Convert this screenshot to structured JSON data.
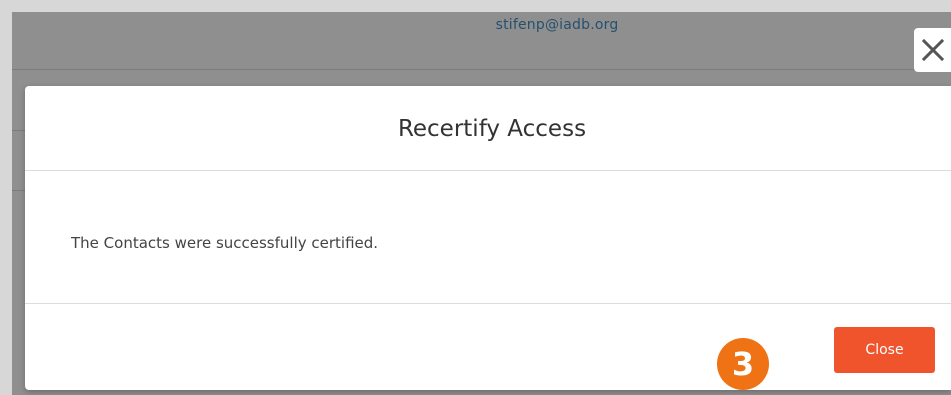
{
  "background": {
    "user_email": "stifenp@iadb.org"
  },
  "modal": {
    "title": "Recertify Access",
    "message": "The Contacts were successfully certified.",
    "close_label": "Close",
    "dismiss_icon": "close-icon"
  },
  "annotation": {
    "step_number": "3"
  },
  "colors": {
    "accent": "#f0542c",
    "badge": "#ef7314",
    "overlay": "#8f8f8f"
  }
}
